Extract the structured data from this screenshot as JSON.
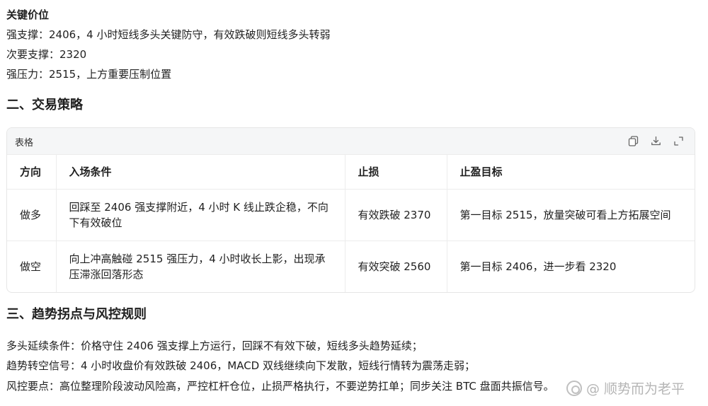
{
  "levels": {
    "heading": "关键价位",
    "lines": [
      "强支撑：2406，4 小时短线多头关键防守，有效跌破则短线多头转弱",
      "次要支撑：2320",
      "强压力：2515，上方重要压制位置"
    ]
  },
  "section2": {
    "title": "二、交易策略",
    "table": {
      "caption": "表格",
      "icons": [
        "copy-icon",
        "download-icon",
        "expand-icon"
      ],
      "headers": [
        "方向",
        "入场条件",
        "止损",
        "止盈目标"
      ],
      "rows": [
        [
          "做多",
          "回踩至 2406 强支撑附近，4 小时 K 线止跌企稳，不向下有效破位",
          "有效跌破 2370",
          "第一目标 2515，放量突破可看上方拓展空间"
        ],
        [
          "做空",
          "向上冲高触碰 2515 强压力，4 小时收长上影，出现承压滞涨回落形态",
          "有效突破 2560",
          "第一目标 2406，进一步看 2320"
        ]
      ]
    }
  },
  "section3": {
    "title": "三、趋势拐点与风控规则",
    "paragraphs": [
      "多头延续条件：价格守住 2406 强支撑上方运行，回踩不有效下破，短线多头趋势延续；",
      "趋势转空信号：4 小时收盘价有效跌破 2406，MACD 双线继续向下发散，短线行情转为震荡走弱；",
      "风控要点：高位整理阶段波动风险高，严控杠杆仓位，止损严格执行，不要逆势扛单；同步关注 BTC 盘面共振信号。"
    ]
  },
  "watermark": "@ 顺势而为老平"
}
